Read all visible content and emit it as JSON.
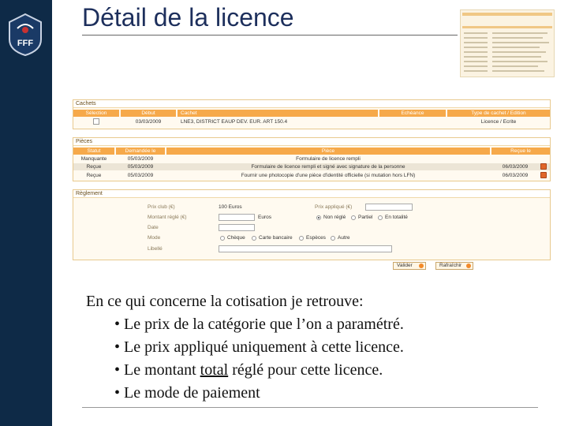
{
  "slide": {
    "title": "Détail de la licence",
    "intro": "En ce qui concerne la cotisation je retrouve:",
    "bullets": [
      {
        "pre": "• Le prix de la catégorie que l’on a paramétré.",
        "u": "",
        "post": ""
      },
      {
        "pre": "• Le prix appliqué uniquement à cette licence.",
        "u": "",
        "post": ""
      },
      {
        "pre": "• Le montant ",
        "u": "total",
        "post": " réglé pour cette licence."
      },
      {
        "pre": "• Le mode de paiement",
        "u": "",
        "post": ""
      }
    ]
  },
  "colors": {
    "sidebar": "#0e2a47",
    "header_orange": "#f6a94a",
    "panel_border": "#e8c98e"
  },
  "logo": {
    "text": "FFF"
  },
  "cachets": {
    "title": "Cachets",
    "headers": [
      "Sélection",
      "Début",
      "Cachet",
      "Echéance",
      "Type de cachet / Edition"
    ],
    "row": {
      "debut": "03/03/2009",
      "cachet": "LNE3, DISTRICT EAUP DEV. EUR. ART 150.4",
      "echeance": "",
      "type": "Licence / Ecrite"
    }
  },
  "pieces": {
    "title": "Pièces",
    "headers": [
      "Statut",
      "Demandée le",
      "Pièce",
      "Reçue le"
    ],
    "rows": [
      {
        "statut": "Manquante",
        "demandee": "05/03/2009",
        "piece": "Formulaire de licence rempli",
        "recue": ""
      },
      {
        "statut": "Reçue",
        "demandee": "05/03/2009",
        "piece": "Formulaire de licence rempli et signé avec signature de la personne",
        "recue": "06/03/2009"
      },
      {
        "statut": "Reçue",
        "demandee": "05/03/2009",
        "piece": "Fournir une photocopie d'une pièce d'identité officielle (si mutation hors LFN)",
        "recue": "06/03/2009"
      }
    ]
  },
  "reglement": {
    "title": "Règlement",
    "prix_club_label": "Prix club (€)",
    "prix_club_value": "100 Euros",
    "prix_applique_label": "Prix appliqué (€)",
    "montant_label": "Montant réglé (€)",
    "montant_unit": "Euros",
    "etat_options": [
      "Non réglé",
      "Partiel",
      "En totalité"
    ],
    "date_label": "Date",
    "mode_label": "Mode",
    "mode_options": [
      "Chèque",
      "Carte bancaire",
      "Espèces",
      "Autre"
    ],
    "libelle_label": "Libellé",
    "valider": "Valider",
    "rafraichir": "Rafraîchir"
  }
}
